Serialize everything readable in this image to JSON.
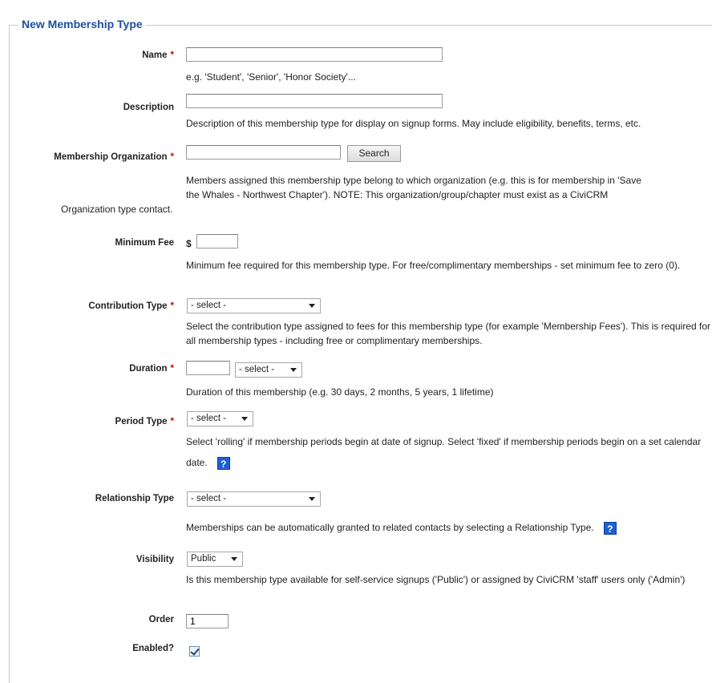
{
  "legend": "New Membership Type",
  "fields": {
    "name": {
      "label": "Name",
      "required": "*",
      "value": "",
      "help": "e.g. 'Student', 'Senior', 'Honor Society'..."
    },
    "description": {
      "label": "Description",
      "value": "",
      "help": "Description of this membership type for display on signup forms. May include eligibility, benefits, terms, etc."
    },
    "organization": {
      "label": "Membership Organization",
      "required": "*",
      "value": "",
      "button": "Search",
      "help_1": "Members assigned this membership type belong to which organization (e.g. this is for membership in 'Save",
      "help_2": "the Whales - Northwest Chapter'). NOTE: This organization/group/chapter must exist as a CiviCRM",
      "help_3": "Organization type contact."
    },
    "minimum_fee": {
      "label": "Minimum Fee",
      "currency": "$",
      "value": "",
      "help": "Minimum fee required for this membership type. For free/complimentary memberships - set minimum fee to zero (0)."
    },
    "contribution_type": {
      "label": "Contribution Type",
      "required": "*",
      "selected": "- select -",
      "help": "Select the contribution type assigned to fees for this membership type (for example 'Membership Fees'). This is required for all membership types - including free or complimentary memberships."
    },
    "duration": {
      "label": "Duration",
      "required": "*",
      "value": "",
      "unit_selected": "- select -",
      "help": "Duration of this membership (e.g. 30 days, 2 months, 5 years, 1 lifetime)"
    },
    "period_type": {
      "label": "Period Type",
      "required": "*",
      "selected": "- select -",
      "help": "Select 'rolling' if membership periods begin at date of signup. Select 'fixed' if membership periods begin on a set calendar date.",
      "help_icon": "?"
    },
    "relationship_type": {
      "label": "Relationship Type",
      "selected": "- select -",
      "help": "Memberships can be automatically granted to related contacts by selecting a Relationship Type.",
      "help_icon": "?"
    },
    "visibility": {
      "label": "Visibility",
      "selected": "Public",
      "help": "Is this membership type available for self-service signups ('Public') or assigned by CiviCRM 'staff' users only ('Admin')"
    },
    "order": {
      "label": "Order",
      "value": "1"
    },
    "enabled": {
      "label": "Enabled?",
      "checked": true
    }
  }
}
